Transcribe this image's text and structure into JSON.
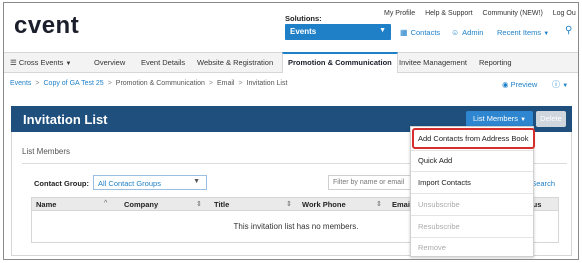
{
  "header": {
    "logo": "cvent",
    "top_links": [
      "My Profile",
      "Help & Support",
      "Community (NEW!)",
      "Log Ou"
    ],
    "solutions_label": "Solutions:",
    "solutions_value": "Events",
    "contacts": "Contacts",
    "admin": "Admin",
    "recent_items": "Recent Items"
  },
  "nav": {
    "cross_events": "Cross Events",
    "items": [
      "Overview",
      "Event Details",
      "Website & Registration",
      "Promotion & Communication",
      "Invitee Management",
      "Reporting"
    ],
    "active": "Promotion & Communication"
  },
  "breadcrumb": {
    "items": [
      "Events",
      "Copy of GA Test 25",
      "Promotion & Communication",
      "Email",
      "Invitation List"
    ],
    "separator": ">",
    "preview": "Preview"
  },
  "page": {
    "title": "Invitation List",
    "members_button": "List Members",
    "delete_button": "Delete",
    "section_title": "List Members",
    "contact_group_label": "Contact Group:",
    "contact_group_value": "All Contact Groups",
    "filter_placeholder": "Filter by name or email",
    "search_link": "d Search"
  },
  "table": {
    "columns": [
      "Name",
      "Company",
      "Title",
      "Work Phone",
      "Email",
      "atus"
    ],
    "empty_message": "This invitation list has no members."
  },
  "menu": {
    "items": [
      {
        "label": "Add Contacts from Address Book",
        "enabled": true,
        "highlighted": true
      },
      {
        "label": "Quick Add",
        "enabled": true
      },
      {
        "label": "Import Contacts",
        "enabled": true
      },
      {
        "label": "Unsubscribe",
        "enabled": false
      },
      {
        "label": "Resubscribe",
        "enabled": false
      },
      {
        "label": "Remove",
        "enabled": false
      }
    ]
  },
  "colors": {
    "accent": "#1f80c8",
    "title_bar": "#1e4f7d",
    "highlight": "#d62d2d"
  }
}
